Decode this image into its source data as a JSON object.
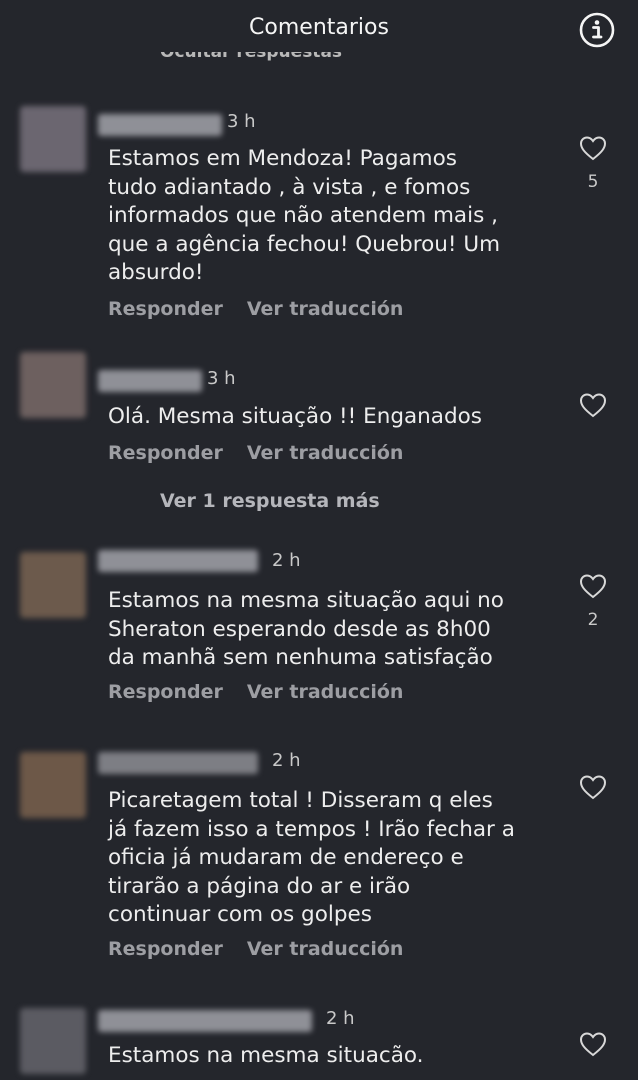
{
  "header": {
    "title": "Comentarios",
    "info_icon": "info-icon",
    "hidden_replies": "Ocultar respuestas"
  },
  "comments": [
    {
      "time": "3 h",
      "text": "Estamos em Mendoza! Pagamos\ntudo adiantado , à vista , e fomos\ninformados que não atendem mais ,\nque a agência fechou! Quebrou! Um\nabsurdo!",
      "likes": "5",
      "reply_label": "Responder",
      "translate_label": "Ver traducción"
    },
    {
      "time": "3 h",
      "text": "Olá. Mesma situação !! Enganados",
      "likes": "",
      "reply_label": "Responder",
      "translate_label": "Ver traducción",
      "more_replies": "Ver 1 respuesta más"
    },
    {
      "time": "2 h",
      "text": "Estamos na mesma situação aqui no\nSheraton esperando desde as 8h00\nda manhã sem nenhuma satisfação",
      "likes": "2",
      "reply_label": "Responder",
      "translate_label": "Ver traducción"
    },
    {
      "time": "2 h",
      "text": "Picaretagem total ! Disseram q eles\njá fazem isso a tempos ! Irão fechar a\noficia já mudaram de endereço e\ntirarão a página do ar e irão\ncontinuar com os golpes",
      "likes": "",
      "reply_label": "Responder",
      "translate_label": "Ver traducción"
    },
    {
      "time": "2 h",
      "text": "Estamos na mesma situacão.",
      "likes": ""
    }
  ],
  "colors": {
    "background": "#24262c",
    "text": "#ededed",
    "muted": "#9d9ea3"
  }
}
